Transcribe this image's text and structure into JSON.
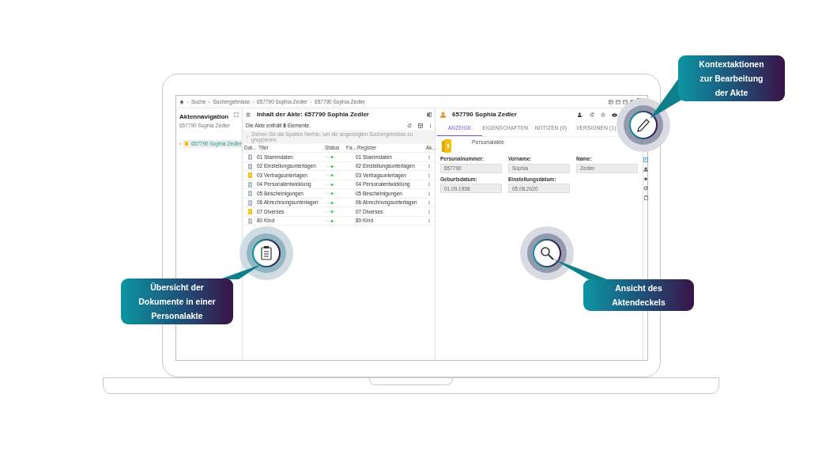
{
  "breadcrumb": [
    {
      "label": "Suche"
    },
    {
      "label": "Suchergebnisse"
    },
    {
      "label": "657790 Sophia Zedler"
    },
    {
      "label": "657790 Sophia Zedler"
    }
  ],
  "navigation": {
    "title": "Aktennavigation",
    "subtitle": "657790 Sophia Zedler",
    "tree": [
      {
        "label": "657790 Sophia Zedler",
        "selected": true
      }
    ]
  },
  "content": {
    "title": "Inhalt der Akte: 657790 Sophia Zedler",
    "count_text": "Die Akte enthält **8** Elemente.",
    "group_hint": "Ziehen Sie die Spalten hierhin, um die angezeigten Suchergebnisse zu gruppieren.",
    "columns": [
      "Dat...",
      "Titel",
      "Status",
      "Fa...",
      "Register",
      "Ak..."
    ],
    "rows": [
      {
        "title": "01 Stammdaten",
        "register": "01 Stammdaten",
        "color": "#b4bcc6"
      },
      {
        "title": "02 Einstellungsunterlagen",
        "register": "02 Einstellungsunterlagen",
        "color": "#b4bcc6"
      },
      {
        "title": "03 Vertragsunterlagen",
        "register": "03 Vertragsunterlagen",
        "color": "#f4c20d"
      },
      {
        "title": "04 Personalentwicklung",
        "register": "04 Personalentwicklung",
        "color": "#b4bcc6"
      },
      {
        "title": "05 Bescheinigungen",
        "register": "05 Bescheinigungen",
        "color": "#b4bcc6"
      },
      {
        "title": "06 Abrechnungsunterlagen",
        "register": "06 Abrechnungsunterlagen",
        "color": "#b4bcc6"
      },
      {
        "title": "07 Diverses",
        "register": "07 Diverses",
        "color": "#f4c20d"
      },
      {
        "title": "80 Kind",
        "register": "80 Kind",
        "color": "#b4bcc6"
      }
    ]
  },
  "record": {
    "title": "657790 Sophia Zedler",
    "tabs": [
      {
        "label": "ANZEIGE",
        "selected": true
      },
      {
        "label": "EIGENSCHAFTEN",
        "selected": false
      },
      {
        "label": "NOTIZEN (0)",
        "selected": false
      },
      {
        "label": "VERSIONEN (1)",
        "selected": false
      }
    ],
    "doc_type": "Personalakte",
    "fields": [
      {
        "label": "Personalnummer:",
        "value": "657790"
      },
      {
        "label": "Vorname:",
        "value": "Sophia"
      },
      {
        "label": "Name:",
        "value": "Zedler"
      },
      {
        "label": "Geburtsdatum:",
        "value": "01.09.1998"
      },
      {
        "label": "Einstellungsdatum:",
        "value": "05.08.2020"
      }
    ]
  },
  "callouts": [
    {
      "kind": "clipboard",
      "lines": [
        "Übersicht der",
        "Dokumente in einer",
        "Personalakte"
      ]
    },
    {
      "kind": "search",
      "lines": [
        "Ansicht des",
        "Aktendeckels"
      ]
    },
    {
      "kind": "pencil",
      "lines": [
        "Kontextaktionen",
        "zur Bearbeitung",
        "der Akte"
      ]
    }
  ]
}
